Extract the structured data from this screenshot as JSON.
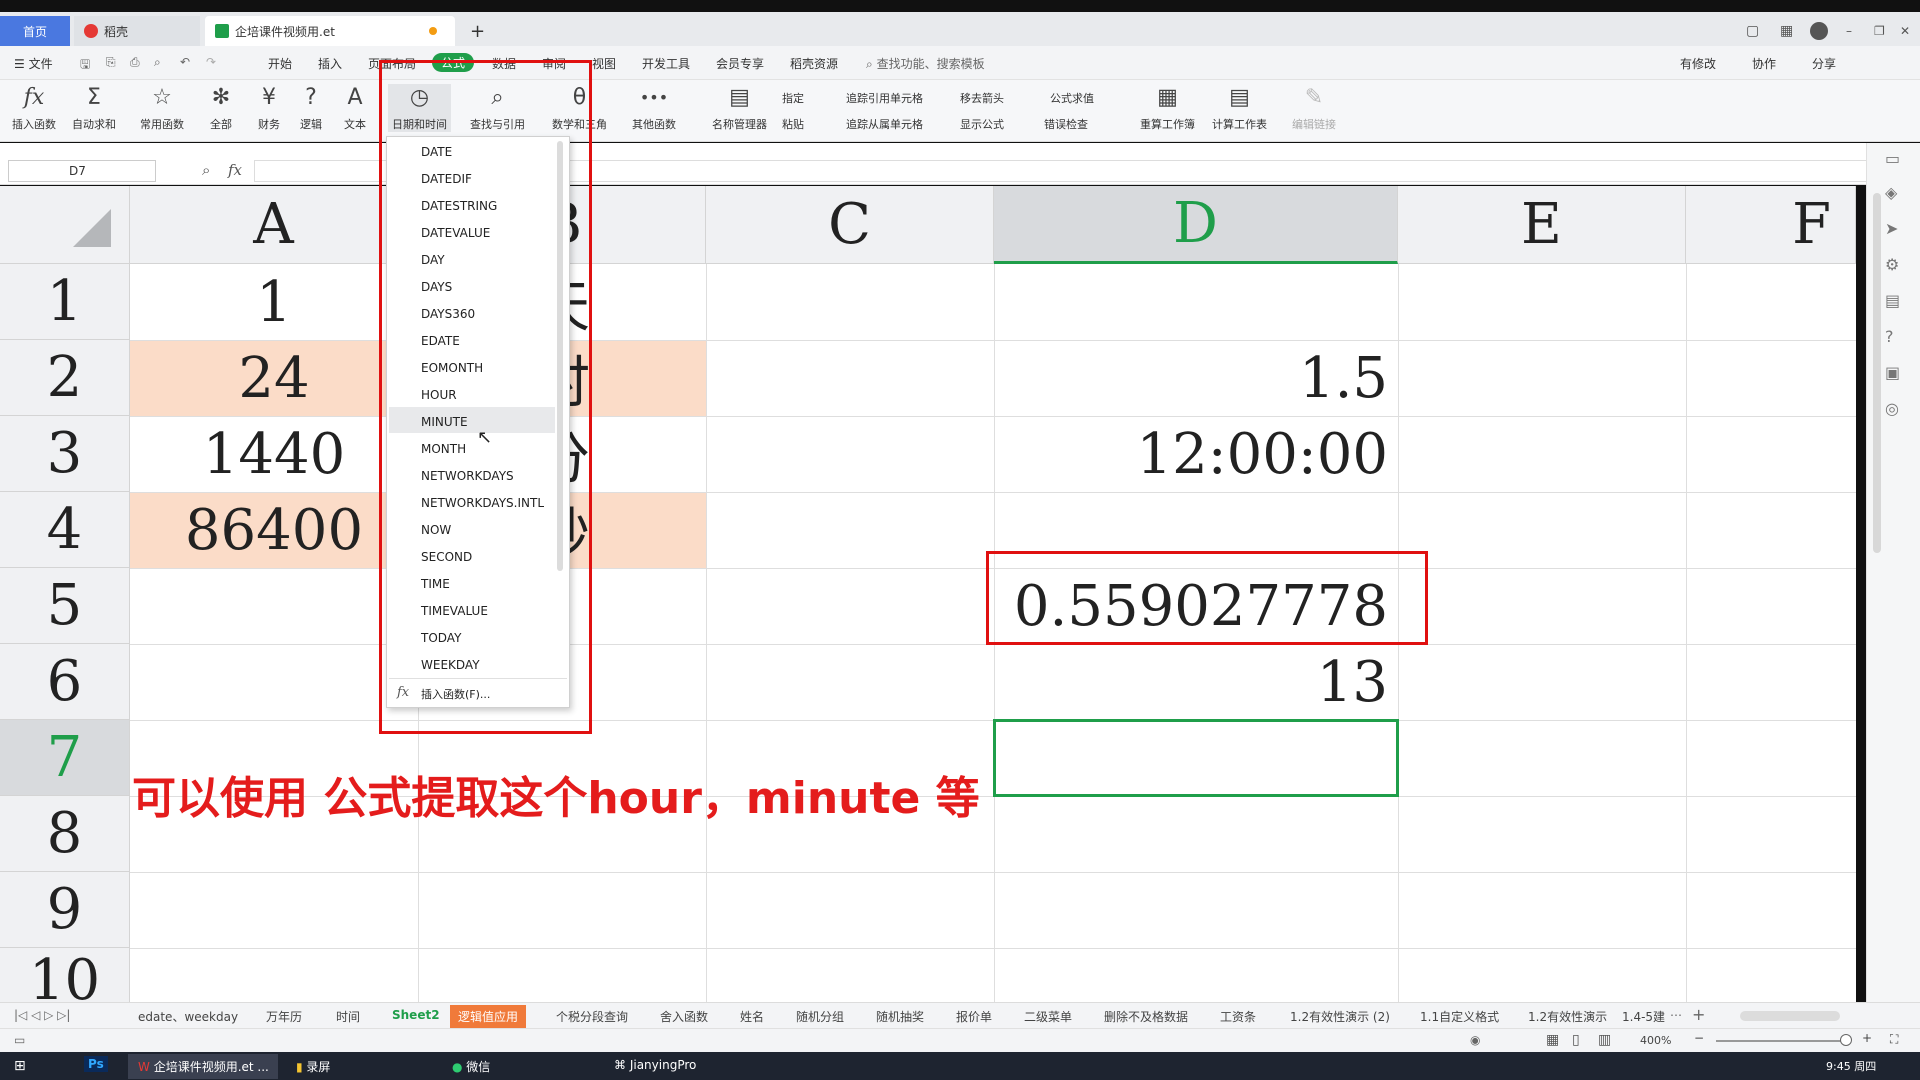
{
  "tabs": {
    "home": "首页",
    "daoke": "稻壳",
    "file": "企培课件视频用.et",
    "add": "+"
  },
  "menu": {
    "file": "文件",
    "items": [
      "开始",
      "插入",
      "页面布局",
      "公式",
      "数据",
      "审阅",
      "视图",
      "开发工具",
      "会员专享",
      "稻壳资源"
    ],
    "search": "查找功能、搜索模板",
    "right": [
      "有修改",
      "协作",
      "分享"
    ]
  },
  "ribbon": {
    "big": [
      {
        "label": "插入函数",
        "icon": "fx"
      },
      {
        "label": "自动求和",
        "icon": "Σ"
      },
      {
        "label": "常用函数",
        "icon": "☆"
      },
      {
        "label": "全部",
        "icon": "✻"
      },
      {
        "label": "财务",
        "icon": "¥"
      },
      {
        "label": "逻辑",
        "icon": "?"
      },
      {
        "label": "文本",
        "icon": "A"
      },
      {
        "label": "日期和时间",
        "icon": "◷"
      },
      {
        "label": "查找与引用",
        "icon": "⌕"
      },
      {
        "label": "数学和三角",
        "icon": "θ"
      },
      {
        "label": "其他函数",
        "icon": "•••"
      },
      {
        "label": "名称管理器",
        "icon": "▤"
      }
    ],
    "small": [
      "指定",
      "粘贴",
      "追踪引用单元格",
      "追踪从属单元格",
      "移去箭头",
      "显示公式",
      "公式求值",
      "错误检查"
    ],
    "big2": [
      {
        "label": "重算工作簿",
        "icon": "▦"
      },
      {
        "label": "计算工作表",
        "icon": "▤"
      },
      {
        "label": "编辑链接",
        "icon": "✎"
      }
    ]
  },
  "formula_bar": {
    "name_box": "D7",
    "fx": "fx"
  },
  "columns": [
    "A",
    "B",
    "C",
    "D",
    "E",
    "F"
  ],
  "rows": [
    "1",
    "2",
    "3",
    "4",
    "5",
    "6",
    "7",
    "8",
    "9",
    "10"
  ],
  "cells": {
    "A1": "1",
    "A2": "24",
    "A3": "1440",
    "A4": "86400",
    "B1": "天",
    "B2": "时",
    "B3": "分",
    "B4": "秒",
    "D2": "1.5",
    "D3": "12:00:00",
    "D5": "0.559027778",
    "D6": "13"
  },
  "dropdown": {
    "items": [
      "DATE",
      "DATEDIF",
      "DATESTRING",
      "DATEVALUE",
      "DAY",
      "DAYS",
      "DAYS360",
      "EDATE",
      "EOMONTH",
      "HOUR",
      "MINUTE",
      "MONTH",
      "NETWORKDAYS",
      "NETWORKDAYS.INTL",
      "NOW",
      "SECOND",
      "TIME",
      "TIMEVALUE",
      "TODAY",
      "WEEKDAY"
    ],
    "hovered": "MINUTE",
    "footer": "插入函数(F)..."
  },
  "annotation": "可以使用 公式提取这个hour，minute 等",
  "sheets": [
    "edate、weekday",
    "万年历",
    "时间",
    "Sheet2",
    "逻辑值应用",
    "个税分段查询",
    "舍入函数",
    "姓名",
    "随机分组",
    "随机抽奖",
    "报价单",
    "二级菜单",
    "删除不及格数据",
    "工资条",
    "1.2有效性演示 (2)",
    "1.1自定义格式",
    "1.2有效性演示",
    "1.4-5建"
  ],
  "active_sheet": "Sheet2",
  "status": {
    "zoom": "400%"
  },
  "taskbar": {
    "items": [
      "企培课件视频用.et ...",
      "录屏",
      "微信",
      "JianyingPro"
    ],
    "time": "9:45 周四"
  },
  "colors": {
    "accent": "#1f9e4a",
    "red": "#e01010",
    "peach": "#fbdcc8"
  }
}
